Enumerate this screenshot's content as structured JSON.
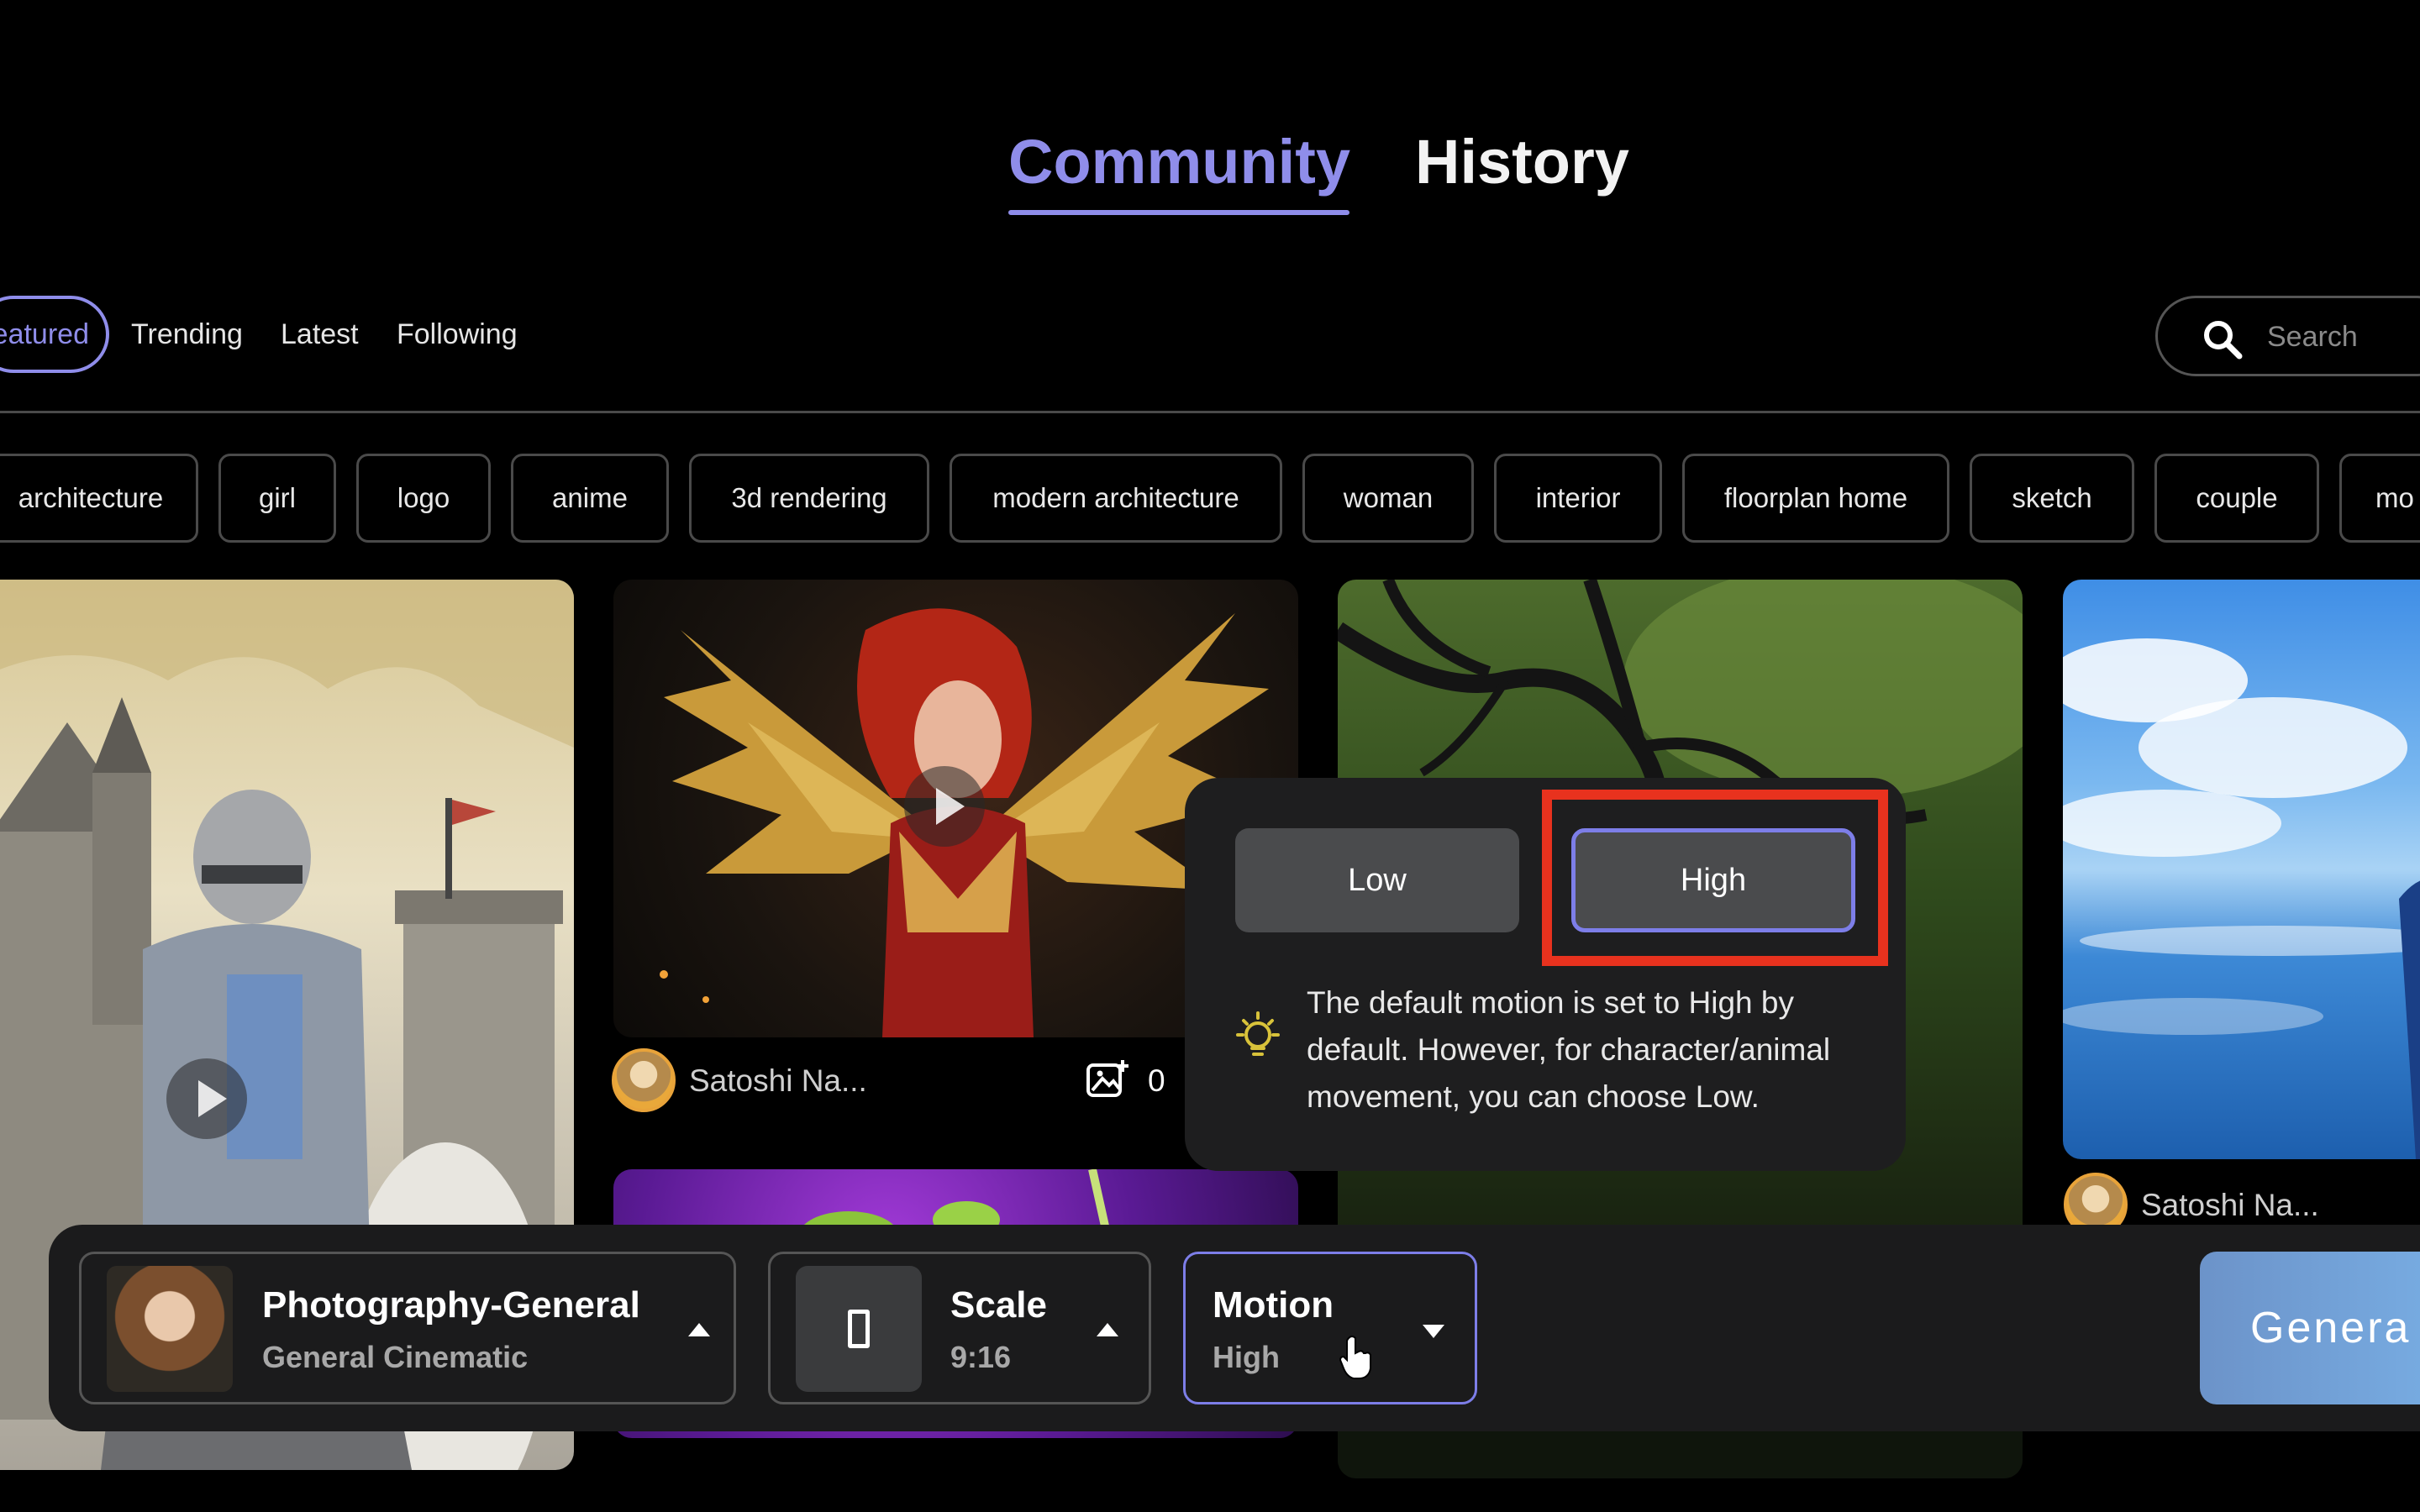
{
  "header": {
    "tabs": [
      {
        "label": "Community",
        "active": true
      },
      {
        "label": "History",
        "active": false
      }
    ]
  },
  "filters": {
    "active": "eatured",
    "links": [
      "Trending",
      "Latest",
      "Following"
    ],
    "search_placeholder": "Search"
  },
  "tags": [
    "architecture",
    "girl",
    "logo",
    "anime",
    "3d rendering",
    "modern architecture",
    "woman",
    "interior",
    "floorplan home",
    "sketch",
    "couple",
    "mo"
  ],
  "cards": {
    "middle": {
      "author": "Satoshi Na...",
      "remix_count": "0"
    },
    "right": {
      "author": "Satoshi Na..."
    }
  },
  "motion_popover": {
    "low_label": "Low",
    "high_label": "High",
    "selected": "High",
    "description": "The default motion is set to High by default. However, for character/animal movement, you can choose Low."
  },
  "toolbar": {
    "style_title": "Photography-General",
    "style_sub": "General Cinematic",
    "scale_title": "Scale",
    "scale_sub": "9:16",
    "motion_title": "Motion",
    "motion_sub": "High",
    "generate_label": "Genera"
  },
  "colors": {
    "accent": "#8f8dea",
    "highlight": "#e8321e",
    "background": "#000000",
    "panel": "#1b1b1c"
  }
}
